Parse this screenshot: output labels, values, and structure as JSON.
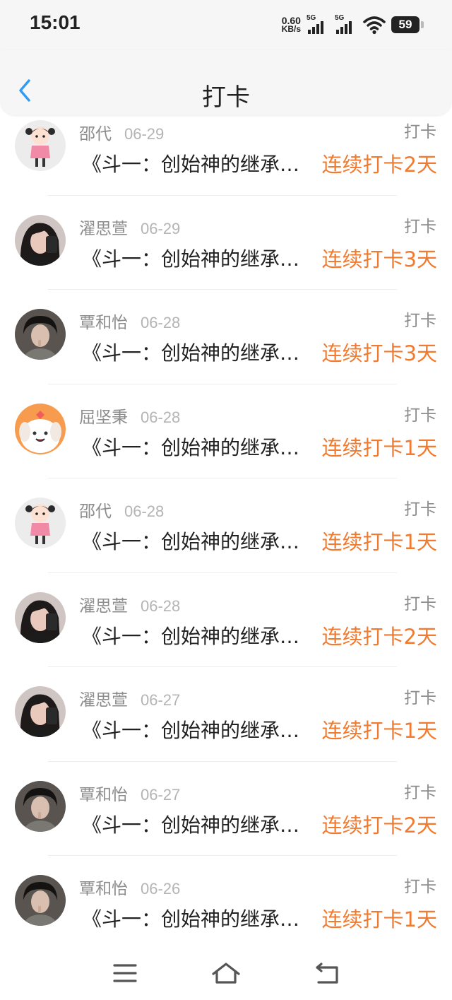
{
  "status_bar": {
    "time": "15:01",
    "net_speed_value": "0.60",
    "net_speed_unit": "KB/s",
    "signal1_label": "5G",
    "signal2_label": "5G",
    "battery": "59"
  },
  "header": {
    "title": "打卡",
    "back_icon": "chevron-left-icon"
  },
  "colors": {
    "accent": "#f27a2e",
    "back": "#2f9bf4",
    "muted": "#8c8c8c"
  },
  "records": [
    {
      "name": "邵代",
      "date": "06-29",
      "tag": "打卡",
      "book": "《斗一：创始神的继承…",
      "streak": "连续打卡2天",
      "avatar": "cartoon-girl"
    },
    {
      "name": "濯思萱",
      "date": "06-29",
      "tag": "打卡",
      "book": "《斗一：创始神的继承…",
      "streak": "连续打卡3天",
      "avatar": "girl-photo"
    },
    {
      "name": "覃和怡",
      "date": "06-28",
      "tag": "打卡",
      "book": "《斗一：创始神的继承…",
      "streak": "连续打卡3天",
      "avatar": "boy-photo"
    },
    {
      "name": "屈坚秉",
      "date": "06-28",
      "tag": "打卡",
      "book": "《斗一：创始神的继承…",
      "streak": "连续打卡1天",
      "avatar": "puppy-cartoon"
    },
    {
      "name": "邵代",
      "date": "06-28",
      "tag": "打卡",
      "book": "《斗一：创始神的继承…",
      "streak": "连续打卡1天",
      "avatar": "cartoon-girl"
    },
    {
      "name": "濯思萱",
      "date": "06-28",
      "tag": "打卡",
      "book": "《斗一：创始神的继承…",
      "streak": "连续打卡2天",
      "avatar": "girl-photo"
    },
    {
      "name": "濯思萱",
      "date": "06-27",
      "tag": "打卡",
      "book": "《斗一：创始神的继承…",
      "streak": "连续打卡1天",
      "avatar": "girl-photo"
    },
    {
      "name": "覃和怡",
      "date": "06-27",
      "tag": "打卡",
      "book": "《斗一：创始神的继承…",
      "streak": "连续打卡2天",
      "avatar": "boy-photo"
    },
    {
      "name": "覃和怡",
      "date": "06-26",
      "tag": "打卡",
      "book": "《斗一：创始神的继承…",
      "streak": "连续打卡1天",
      "avatar": "boy-photo"
    }
  ],
  "system_nav": {
    "menu_icon": "menu-icon",
    "home_icon": "home-icon",
    "back_icon": "return-icon"
  }
}
